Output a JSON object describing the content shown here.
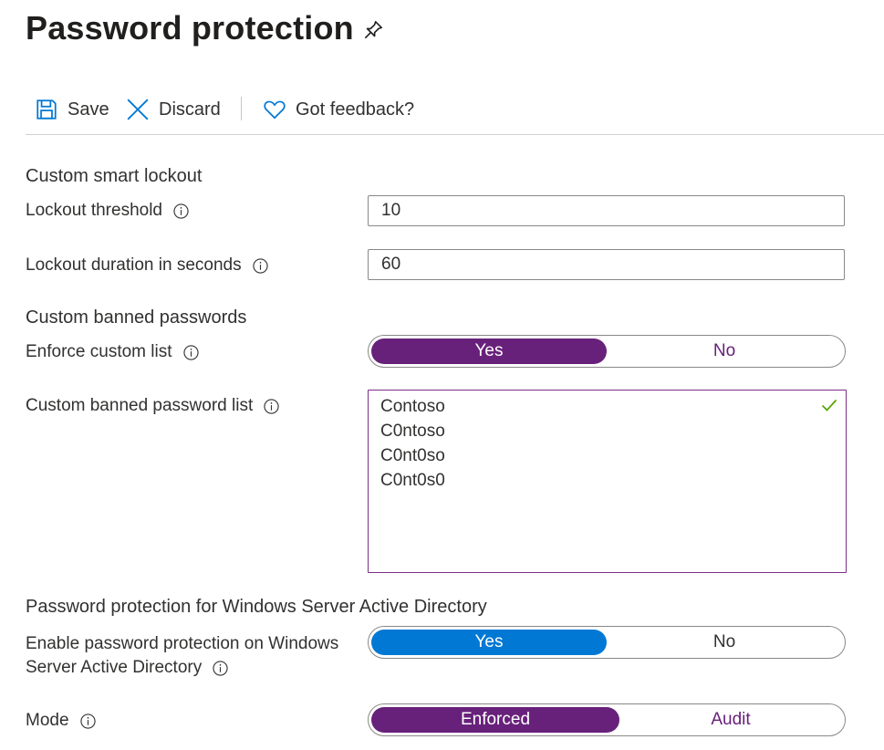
{
  "page": {
    "title": "Password protection"
  },
  "toolbar": {
    "save_label": "Save",
    "discard_label": "Discard",
    "feedback_label": "Got feedback?"
  },
  "smart_lockout": {
    "heading": "Custom smart lockout",
    "threshold_label": "Lockout threshold",
    "threshold_value": "10",
    "duration_label": "Lockout duration in seconds",
    "duration_value": "60"
  },
  "banned_passwords": {
    "heading": "Custom banned passwords",
    "enforce_label": "Enforce custom list",
    "enforce_options": [
      "Yes",
      "No"
    ],
    "enforce_selected": "Yes",
    "list_label": "Custom banned password list",
    "list_items": [
      "Contoso",
      "C0ntoso",
      "C0nt0so",
      "C0nt0s0"
    ]
  },
  "windows_ad": {
    "heading": "Password protection for Windows Server Active Directory",
    "enable_label_line1": "Enable password protection on Windows",
    "enable_label_line2": "Server Active Directory",
    "enable_options": [
      "Yes",
      "No"
    ],
    "enable_selected": "Yes",
    "mode_label": "Mode",
    "mode_options": [
      "Enforced",
      "Audit"
    ],
    "mode_selected": "Enforced"
  },
  "colors": {
    "purple": "#68217a",
    "blue": "#0078d4",
    "check_green": "#57a300",
    "text": "#323130"
  },
  "icons": [
    "pin-icon",
    "save-icon",
    "discard-icon",
    "heart-icon",
    "info-icon",
    "checkmark-icon"
  ]
}
